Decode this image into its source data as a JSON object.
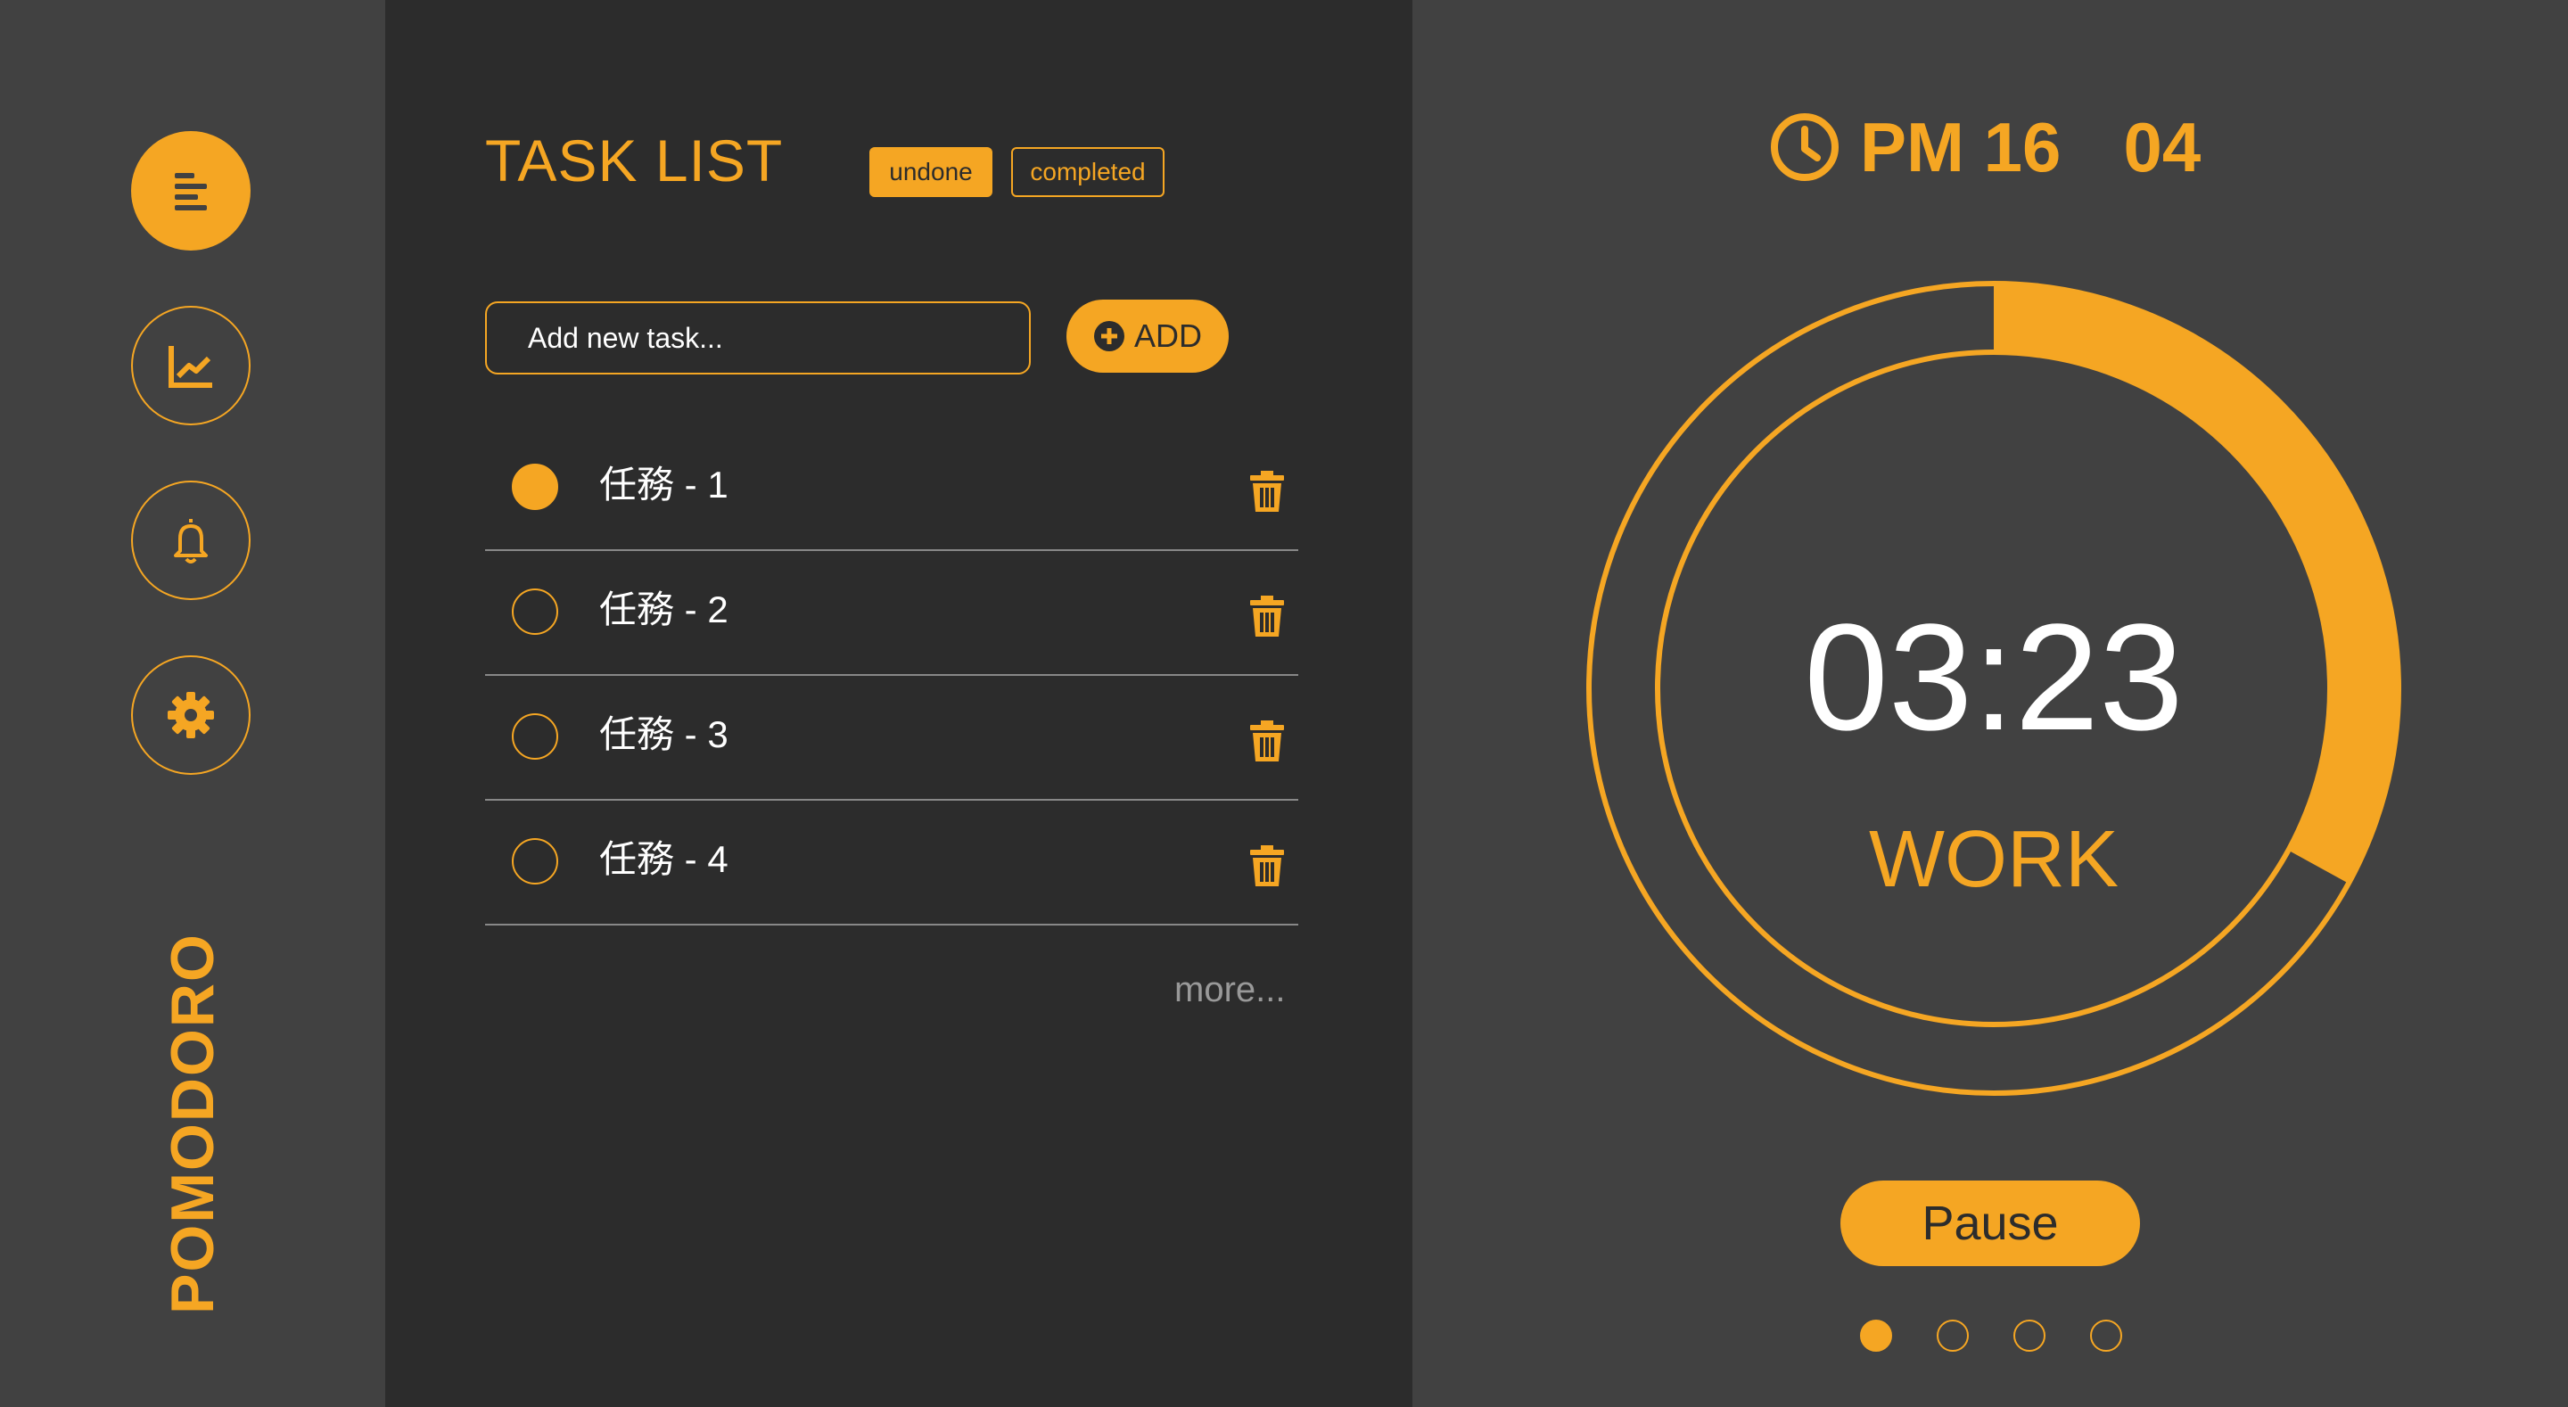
{
  "colors": {
    "accent": "#F5A623",
    "sidebar_bg": "#414141",
    "panel_bg": "#2C2C2C",
    "divider": "#888888"
  },
  "sidebar": {
    "items": [
      {
        "icon": "list-icon",
        "active": true
      },
      {
        "icon": "chart-icon",
        "active": false
      },
      {
        "icon": "bell-icon",
        "active": false
      },
      {
        "icon": "gear-icon",
        "active": false
      }
    ],
    "brand": "POMODORO"
  },
  "tasks": {
    "title": "TASK LIST",
    "filters": {
      "undone": "undone",
      "completed": "completed",
      "active": "undone"
    },
    "input": {
      "placeholder": "Add new task..."
    },
    "add_label": "ADD",
    "items": [
      {
        "label": "任務 - 1",
        "done": true
      },
      {
        "label": "任務 - 2",
        "done": false
      },
      {
        "label": "任務 - 3",
        "done": false
      },
      {
        "label": "任務 - 4",
        "done": false
      }
    ],
    "more": "more..."
  },
  "timer": {
    "clock_period": "PM 16",
    "clock_minute": "04",
    "countdown": "03:23",
    "mode": "WORK",
    "progress": 0.33,
    "pause_label": "Pause",
    "pages": 4,
    "active_page": 1
  }
}
